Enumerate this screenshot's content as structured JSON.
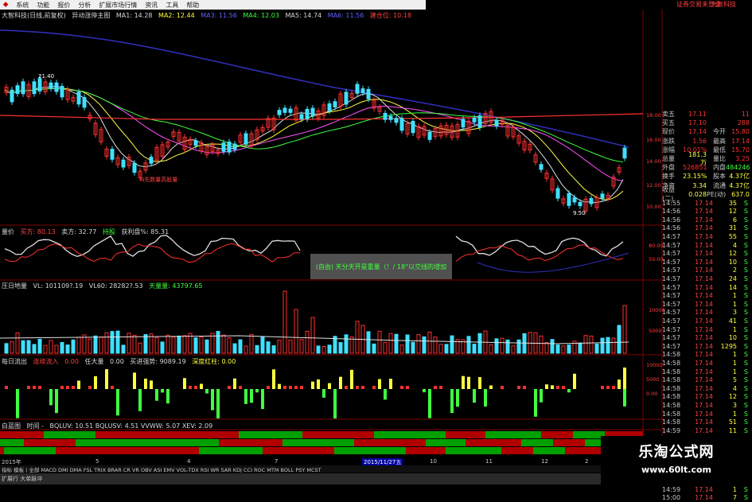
{
  "menubar": {
    "items": [
      "系统",
      "功能",
      "报价",
      "分析",
      "扩展市场行情",
      "资讯",
      "工具",
      "帮助"
    ],
    "right_link": "证券交易未登录",
    "right_link2": "大智科技"
  },
  "main_header": {
    "stock": "大智科技(日线,前复权)",
    "indicator": "异动涨停主图",
    "ma1": "MA1: 14.28",
    "ma2": "MA2: 12.44",
    "ma3": "MA3: 11.56",
    "ma4": "MA4: 12.03",
    "ma5": "MA5: 14.74",
    "ma6": "MA6: 11.56",
    "extra": "建仓位: 10.18"
  },
  "price_labels": {
    "high_mark": "21.40",
    "low_mark": "9.50",
    "annotation": "N先数量高股量"
  },
  "price_axis": [
    "18.00",
    "16.00",
    "14.00",
    "12.00",
    "10.00"
  ],
  "osc_header": {
    "name": "量价",
    "buy": "买方: 80.13",
    "sell": "卖方: 32.77",
    "hold": "持股",
    "profit": "获利盘%: 85.31"
  },
  "osc_axis": [
    "80.00",
    "50.00"
  ],
  "popup_text": "(自由) 天分天开是重量（！/ 18°以交线的增加",
  "vol_header": {
    "name": "压日地量",
    "vl": "VL: 101109?.19",
    "vl60": "VL60: 28282?.53",
    "vol2": "天量量: 43797.65"
  },
  "vol_axis": [
    "10000",
    "5000"
  ],
  "flow_header": {
    "name": "每日流出",
    "a": "连续流入",
    "b": "0.00",
    "c": "任大量",
    "d": "0.00",
    "e": "买进强势: 9089.19",
    "f": "深度红柱: 0.00"
  },
  "flow_axis": [
    "10000",
    "5000",
    "0.00"
  ],
  "band_header": {
    "name": "白蓝图",
    "time": "时间 -",
    "values": "BQLUV: 10.51  BQLUSV: 4.51  VVWW: 5.07  XEV: 2.09"
  },
  "xaxis": {
    "left": "2015年",
    "marker": "2015/11/27五",
    "ticks": [
      "5",
      "4",
      "7",
      "10",
      "11",
      "12",
      "2"
    ]
  },
  "quote": {
    "rows": [
      {
        "l": "卖五",
        "v1": "17.11",
        "l2": "",
        "v2": "11"
      },
      {
        "l": "买五",
        "v1": "17.10",
        "l2": "",
        "v2": "288"
      },
      {
        "l": "现价",
        "v1": "17.14",
        "l2": "今开",
        "v2": "15.80"
      },
      {
        "l": "涨跌",
        "v1": "1.56",
        "l2": "最高",
        "v2": "17.14"
      },
      {
        "l": "涨幅",
        "v1": "10.01%",
        "l2": "最低",
        "v2": "15.70"
      },
      {
        "l": "总量",
        "v1": "181.3万",
        "l2": "量比",
        "v2": "3.25"
      },
      {
        "l": "外盘",
        "v1": "526851",
        "l2": "内盘",
        "v2": "484246"
      },
      {
        "l": "换手",
        "v1": "23.15%",
        "l2": "股本",
        "v2": "4.37亿"
      },
      {
        "l": "净资",
        "v1": "3.34",
        "l2": "流通",
        "v2": "4.37亿"
      },
      {
        "l": "收益(二)",
        "v1": "0.028",
        "l2": "PE(动)",
        "v2": "637.0"
      }
    ],
    "ticks": [
      {
        "t": "14:55",
        "p": "17.14",
        "n": "35",
        "f": "S"
      },
      {
        "t": "14:56",
        "p": "17.14",
        "n": "12",
        "f": "S"
      },
      {
        "t": "14:56",
        "p": "17.14",
        "n": "6",
        "f": "S"
      },
      {
        "t": "14:56",
        "p": "17.14",
        "n": "31",
        "f": "S"
      },
      {
        "t": "14:57",
        "p": "17.14",
        "n": "55",
        "f": "S"
      },
      {
        "t": "14:57",
        "p": "17.14",
        "n": "4",
        "f": "S"
      },
      {
        "t": "14:57",
        "p": "17.14",
        "n": "12",
        "f": "S"
      },
      {
        "t": "14:57",
        "p": "17.14",
        "n": "10",
        "f": "S"
      },
      {
        "t": "14:57",
        "p": "17.14",
        "n": "2",
        "f": "S"
      },
      {
        "t": "14:57",
        "p": "17.14",
        "n": "24",
        "f": "S"
      },
      {
        "t": "14:57",
        "p": "17.14",
        "n": "14",
        "f": "S"
      },
      {
        "t": "14:57",
        "p": "17.14",
        "n": "1",
        "f": "S"
      },
      {
        "t": "14:57",
        "p": "17.14",
        "n": "1",
        "f": "S"
      },
      {
        "t": "14:57",
        "p": "17.14",
        "n": "3",
        "f": "S"
      },
      {
        "t": "14:57",
        "p": "17.14",
        "n": "41",
        "f": "S"
      },
      {
        "t": "14:57",
        "p": "17.14",
        "n": "1",
        "f": "S"
      },
      {
        "t": "14:57",
        "p": "17.14",
        "n": "10",
        "f": "S"
      },
      {
        "t": "14:57",
        "p": "17.14",
        "n": "1295",
        "f": "S"
      },
      {
        "t": "14:58",
        "p": "17.14",
        "n": "1",
        "f": "S"
      },
      {
        "t": "14:58",
        "p": "17.14",
        "n": "1",
        "f": "S"
      },
      {
        "t": "14:58",
        "p": "17.14",
        "n": "1",
        "f": "S"
      },
      {
        "t": "14:58",
        "p": "17.14",
        "n": "5",
        "f": "S"
      },
      {
        "t": "14:58",
        "p": "17.14",
        "n": "4",
        "f": "S"
      },
      {
        "t": "14:58",
        "p": "17.14",
        "n": "12",
        "f": "S"
      },
      {
        "t": "14:58",
        "p": "17.14",
        "n": "3",
        "f": "S"
      },
      {
        "t": "14:58",
        "p": "17.14",
        "n": "1",
        "f": "S"
      },
      {
        "t": "14:58",
        "p": "17.14",
        "n": "51",
        "f": "S"
      },
      {
        "t": "14:59",
        "p": "17.14",
        "n": "11",
        "f": "S"
      },
      {
        "t": "14:59",
        "p": "17.14",
        "n": "31",
        "f": "S"
      },
      {
        "t": "14:59",
        "p": "17.14",
        "n": "1",
        "f": "S"
      },
      {
        "t": "14:59",
        "p": "17.14",
        "n": "3",
        "f": "S"
      },
      {
        "t": "14:59",
        "p": "17.14",
        "n": "3",
        "f": "S"
      },
      {
        "t": "14:59",
        "p": "17.14",
        "n": "1",
        "f": "S"
      },
      {
        "t": "14:59",
        "p": "17.14",
        "n": "3",
        "f": "S"
      },
      {
        "t": "14:59",
        "p": "17.14",
        "n": "1",
        "f": "S"
      },
      {
        "t": "15:00",
        "p": "17.14",
        "n": "7",
        "f": "S"
      }
    ]
  },
  "tabbar": "指标 模板 | 全部 MACD DMI DMA FSL TRIX BRAR CR VR OBV ASI EMV VOL-TDX RSI WR SAR KDJ CCI ROC MTM BOLL PSY MCST",
  "statusbar": "扩展行 大单脉冲",
  "watermark": {
    "line1": "乐淘公式网",
    "line2": "www.60lt.com"
  },
  "colors": {
    "up": "#ff3030",
    "down": "#40e0ff",
    "green": "#40ff40",
    "yellow": "#ffff40"
  }
}
